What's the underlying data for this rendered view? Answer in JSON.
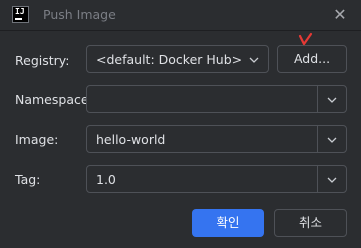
{
  "window": {
    "title": "Push Image",
    "app_icon_text": "IJ",
    "close_icon": "close-icon"
  },
  "form": {
    "registry": {
      "label": "Registry:",
      "value": "<default: Docker Hub>",
      "add_button": "Add..."
    },
    "namespace": {
      "label": "Namespace:",
      "value": ""
    },
    "image": {
      "label": "Image:",
      "value": "hello-world"
    },
    "tag": {
      "label": "Tag:",
      "value": "1.0"
    }
  },
  "footer": {
    "ok_label": "확인",
    "cancel_label": "취소"
  },
  "colors": {
    "background": "#2b2d30",
    "primary_button": "#3574f0",
    "annotation": "#e53935"
  }
}
